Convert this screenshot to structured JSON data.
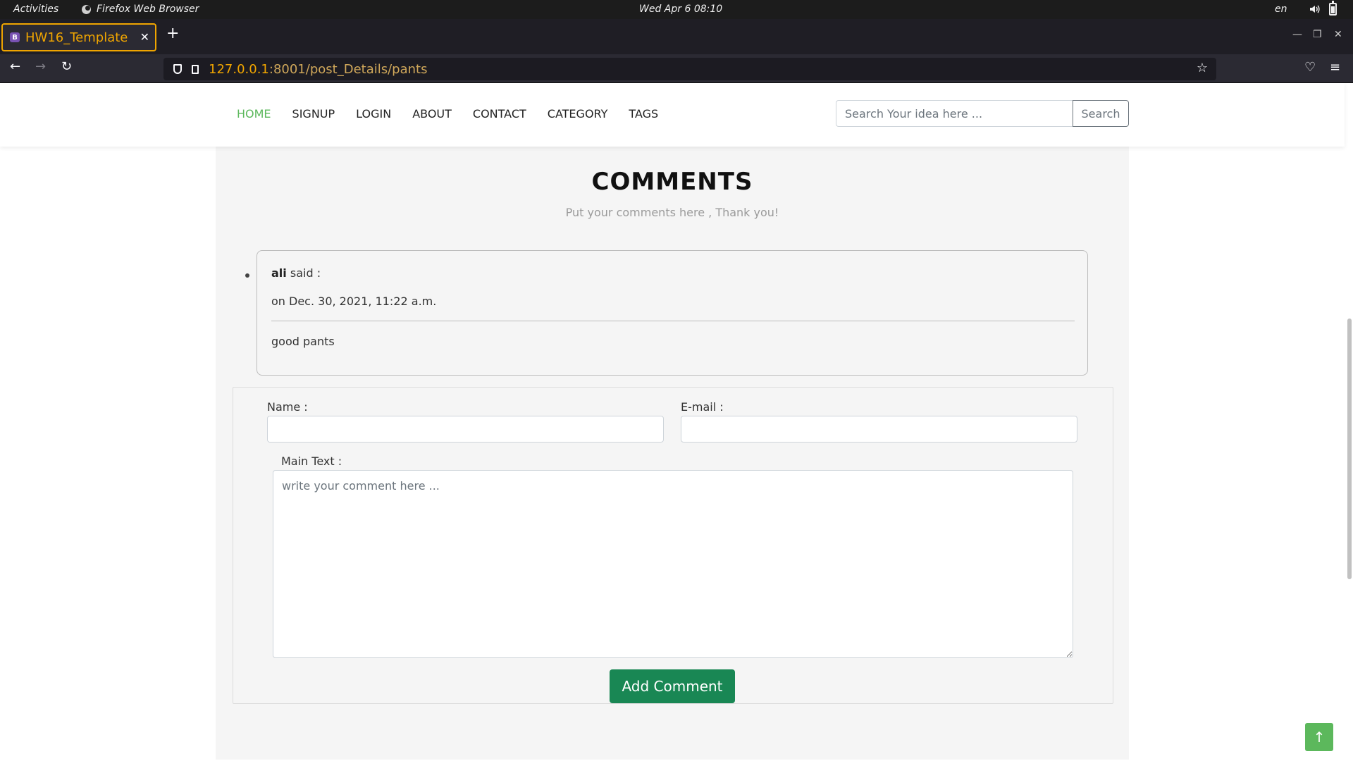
{
  "system_bar": {
    "activities": "Activities",
    "app_name": "Firefox Web Browser",
    "clock": "Wed Apr 6  08:10",
    "language": "en"
  },
  "browser": {
    "tab_title": "HW16_Template",
    "tab_favicon_letter": "B",
    "url_host": "127.0.0.1",
    "url_path": ":8001/post_Details/pants"
  },
  "site": {
    "menu": [
      "HOME",
      "SIGNUP",
      "LOGIN",
      "ABOUT",
      "CONTACT",
      "CATEGORY",
      "TAGS"
    ],
    "active_menu": "HOME",
    "search_placeholder": "Search Your idea here ...",
    "search_button": "Search"
  },
  "comments": {
    "title": "COMMENTS",
    "subtitle": "Put your comments here , Thank you!",
    "items": [
      {
        "author": "ali",
        "said": "said :",
        "date": "on Dec. 30, 2021, 11:22 a.m.",
        "text": "good pants"
      }
    ]
  },
  "form": {
    "name_label": "Name :",
    "email_label": "E-mail :",
    "main_text_label": "Main Text :",
    "main_text_placeholder": "write your comment here ...",
    "submit_label": "Add Comment"
  },
  "colors": {
    "accent_green": "#198754",
    "active_menu": "#5cb85c",
    "tab_highlight": "#f0a500"
  },
  "icons": [
    "firefox-icon",
    "volume-icon",
    "battery-icon",
    "back-icon",
    "forward-icon",
    "reload-icon",
    "shield-icon",
    "page-icon",
    "bookmark-star-icon",
    "pocket-icon",
    "menu-icon",
    "arrow-up-icon"
  ]
}
